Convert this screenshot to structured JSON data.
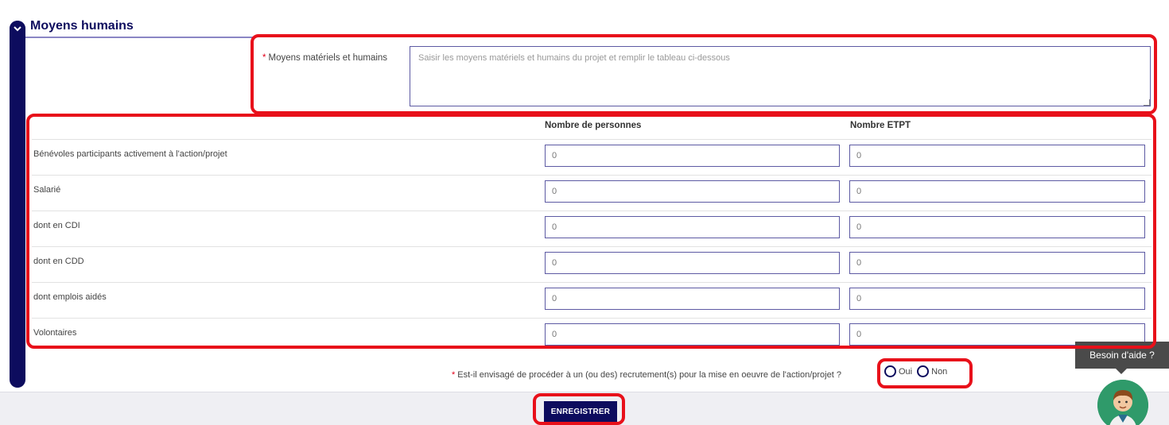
{
  "section": {
    "title": "Moyens humains"
  },
  "material": {
    "label": "Moyens matériels et humains",
    "required_mark": "*",
    "placeholder": "Saisir les moyens matériels et humains du projet et remplir le tableau ci-dessous",
    "value": ""
  },
  "table": {
    "columns": [
      "",
      "Nombre de personnes",
      "Nombre ETPT"
    ],
    "rows": [
      {
        "label": "Bénévoles participants activement à l'action/projet",
        "persons": "0",
        "etpt": "0"
      },
      {
        "label": "Salarié",
        "persons": "0",
        "etpt": "0"
      },
      {
        "label": "dont en CDI",
        "persons": "0",
        "etpt": "0"
      },
      {
        "label": "dont en CDD",
        "persons": "0",
        "etpt": "0"
      },
      {
        "label": "dont emplois aidés",
        "persons": "0",
        "etpt": "0"
      },
      {
        "label": "Volontaires",
        "persons": "0",
        "etpt": "0"
      }
    ]
  },
  "recruitment": {
    "required_mark": "*",
    "question": "Est-il envisagé de procéder à un (ou des) recrutement(s) pour la mise en oeuvre de l'action/projet ?",
    "options": [
      "Oui",
      "Non"
    ],
    "selected": ""
  },
  "footer": {
    "save_label": "ENREGISTRER"
  },
  "help": {
    "tooltip": "Besoin d'aide ?",
    "avatar_icon": "assistant-avatar-icon"
  },
  "colors": {
    "primary": "#0d0c5e",
    "required": "#e2001a",
    "highlight": "#e8101a",
    "help_green": "#2f9a6a"
  }
}
